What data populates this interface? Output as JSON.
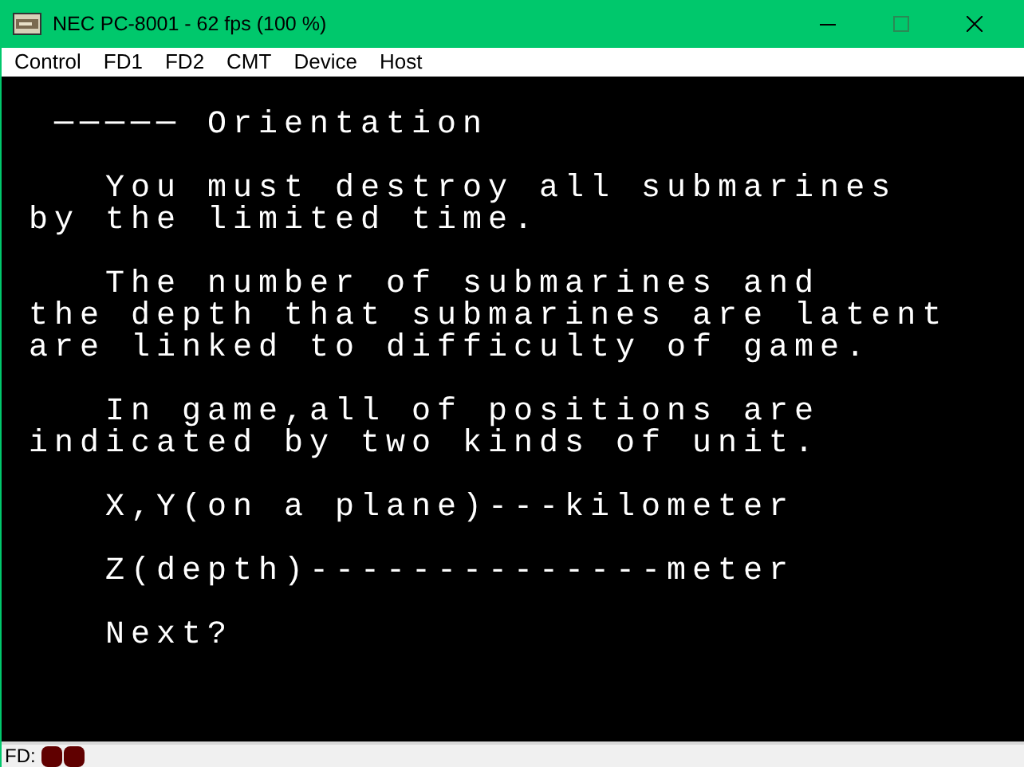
{
  "window": {
    "title": "NEC PC-8001 - 62 fps (100 %)"
  },
  "menu": [
    "Control",
    "FD1",
    "FD2",
    "CMT",
    "Device",
    "Host"
  ],
  "screen": {
    "paragraphs": [
      [
        " ───── Orientation"
      ],
      [
        "   You must destroy all submarines",
        "by the limited time."
      ],
      [
        "   The number of submarines and",
        "the depth that submarines are latent",
        "are linked to difficulty of game."
      ],
      [
        "   In game,all of positions are",
        "indicated by two kinds of unit."
      ],
      [
        "   X,Y(on a plane)---kilometer"
      ],
      [
        "   Z(depth)--------------meter"
      ],
      [
        "   Next?"
      ]
    ]
  },
  "status_bar": {
    "label": "FD:",
    "drives": [
      {
        "on": false
      },
      {
        "on": false
      }
    ]
  }
}
